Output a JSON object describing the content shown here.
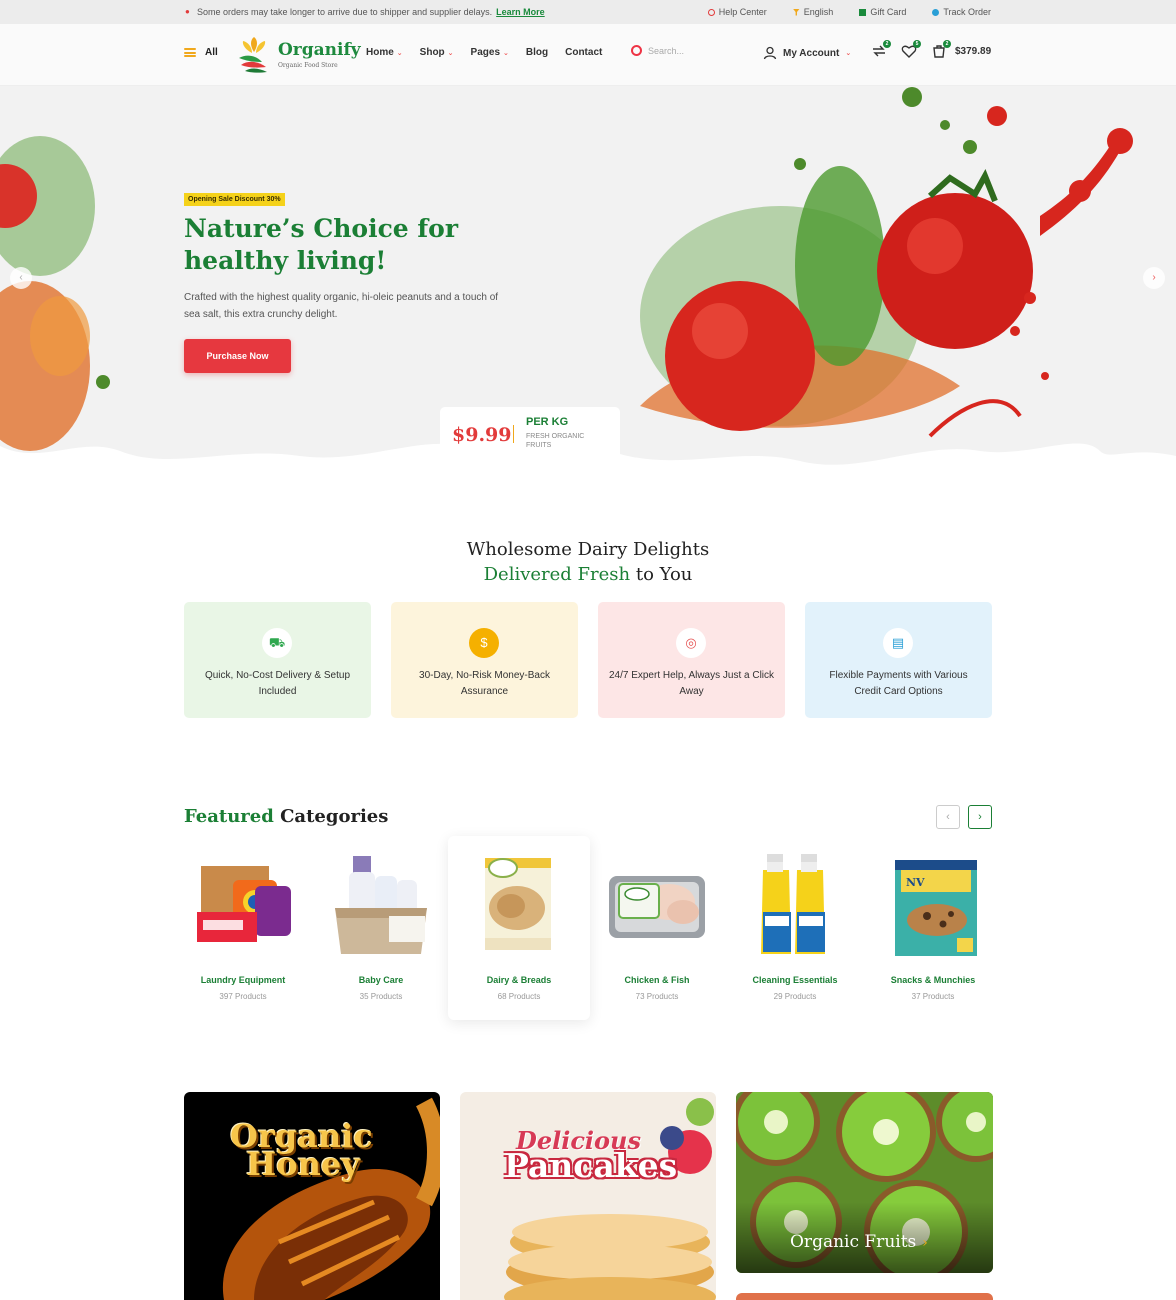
{
  "topbar": {
    "message": "Some orders may take longer to arrive due to shipper and supplier delays.",
    "learn_more": "Learn More",
    "links": [
      {
        "label": "Help Center",
        "icon": "help-icon",
        "color": "#e23b3b"
      },
      {
        "label": "English",
        "icon": "language-icon",
        "color": "#f0a81c"
      },
      {
        "label": "Gift Card",
        "icon": "gift-icon",
        "color": "#1a8a3c"
      },
      {
        "label": "Track Order",
        "icon": "track-icon",
        "color": "#2a9fd6"
      }
    ]
  },
  "header": {
    "menu_label": "All",
    "logo_name": "Organify",
    "logo_tagline": "Organic Food Store",
    "nav": [
      {
        "label": "Home",
        "dropdown": true
      },
      {
        "label": "Shop",
        "dropdown": true
      },
      {
        "label": "Pages",
        "dropdown": true
      },
      {
        "label": "Blog",
        "dropdown": false
      },
      {
        "label": "Contact",
        "dropdown": false
      }
    ],
    "search_placeholder": "Search...",
    "account_label": "My Account",
    "compare_count": "2",
    "wishlist_count": "5",
    "cart_count": "2",
    "cart_total": "$379.89"
  },
  "hero": {
    "badge": "Opening Sale Discount 30%",
    "title": "Nature’s Choice for healthy living!",
    "description": "Crafted with the highest quality organic, hi-oleic peanuts and a touch  of sea salt, this extra crunchy delight.",
    "button": "Purchase Now",
    "price": "$9.99",
    "price_unit": "PER KG",
    "price_note": "FRESH ORGANIC FRUITS"
  },
  "section": {
    "line1": "Wholesome Dairy Delights",
    "line2_green": "Delivered Fresh",
    "line2_rest": " to You"
  },
  "features": [
    {
      "text": "Quick, No-Cost Delivery & Setup Included",
      "icon": "truck-icon",
      "bg": "#e9f6e6",
      "accent": "#2fa84f"
    },
    {
      "text": "30-Day, No-Risk Money-Back Assurance",
      "icon": "dollar-icon",
      "bg": "#fdf4dc",
      "accent": "#f5b000"
    },
    {
      "text": "24/7 Expert Help, Always Just a Click Away",
      "icon": "support-icon",
      "bg": "#fde6e6",
      "accent": "#e55353"
    },
    {
      "text": "Flexible Payments with Various Credit Card Options",
      "icon": "credit-card-icon",
      "bg": "#e2f2fb",
      "accent": "#2a9fd6"
    }
  ],
  "featured": {
    "title_green": "Featured",
    "title_rest": " Categories",
    "categories": [
      {
        "name": "Laundry Equipment",
        "count": "397 Products"
      },
      {
        "name": "Baby Care",
        "count": "35 Products"
      },
      {
        "name": "Dairy & Breads",
        "count": "68 Products"
      },
      {
        "name": "Chicken & Fish",
        "count": "73 Products"
      },
      {
        "name": "Cleaning Essentials",
        "count": "29 Products"
      },
      {
        "name": "Snacks & Munchies",
        "count": "37 Products"
      }
    ]
  },
  "banners": {
    "honey_1": "Organic",
    "honey_2": "Honey",
    "pancake_1": "Delicious",
    "pancake_2": "Pancakes",
    "fruits": "Organic Fruits"
  }
}
